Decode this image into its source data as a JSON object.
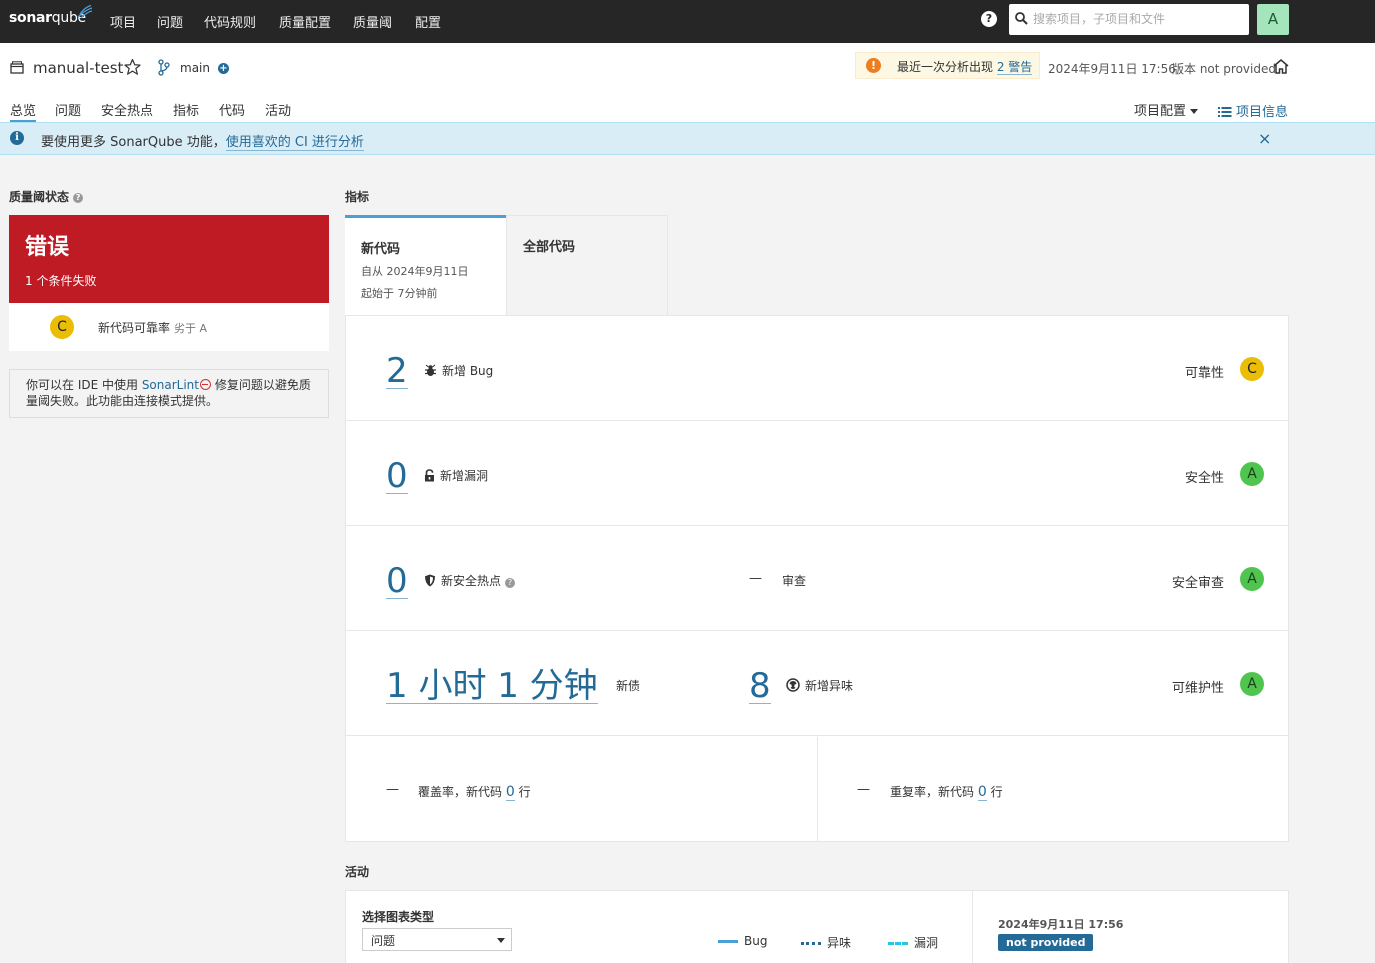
{
  "topnav": {
    "logo_bold": "sonar",
    "logo_light": "qube",
    "items": [
      "项目",
      "问题",
      "代码规则",
      "质量配置",
      "质量阈",
      "配置"
    ],
    "help": "?",
    "search_placeholder": "搜索项目，子项目和文件",
    "avatar": "A"
  },
  "project": {
    "name": "manual-test",
    "branch": "main",
    "warning_text": "最近一次分析出现",
    "warning_link": "2 警告",
    "analysis_date": "2024年9月11日 17:56",
    "version": "版本 not provided",
    "tabs": [
      "总览",
      "问题",
      "安全热点",
      "指标",
      "代码",
      "活动"
    ],
    "settings": "项目配置",
    "info": "项目信息"
  },
  "banner": {
    "text": "要使用更多 SonarQube 功能，",
    "link": "使用喜欢的 CI 进行分析",
    "close": "×"
  },
  "quality_gate": {
    "title": "质量阈状态",
    "status": "错误",
    "failed": "1 个条件失败",
    "condition_rating": "C",
    "condition_text": "新代码可靠率",
    "condition_sub": "劣于 A",
    "sonarlint_pre": "你可以在 IDE 中使用 ",
    "sonarlint_link": "SonarLint",
    "sonarlint_post": " 修复问题以避免质量阈失败。此功能由连接模式提供。"
  },
  "measures": {
    "title": "指标",
    "tab_new": "新代码",
    "tab_new_since": "自从 2024年9月11日",
    "tab_new_started": "起始于 7分钟前",
    "tab_all": "全部代码",
    "bugs": "2",
    "bugs_label": "新增 Bug",
    "reliability": "可靠性",
    "reliability_rating": "C",
    "vulns": "0",
    "vulns_label": "新增漏洞",
    "security": "安全性",
    "security_rating": "A",
    "hotspots": "0",
    "hotspots_label": "新安全热点",
    "review_dash": "—",
    "review_label": "审查",
    "security_review": "安全审查",
    "security_review_rating": "A",
    "debt": "1 小时 1 分钟",
    "debt_label": "新债",
    "smells": "8",
    "smells_label": "新增异味",
    "maintainability": "可维护性",
    "maintainability_rating": "A",
    "coverage_dash": "—",
    "coverage_label": "覆盖率，新代码",
    "coverage_lines": "0",
    "coverage_unit": "行",
    "dup_dash": "—",
    "dup_label": "重复率，新代码",
    "dup_lines": "0",
    "dup_unit": "行"
  },
  "activity": {
    "title": "活动",
    "chart_type_label": "选择图表类型",
    "chart_type_value": "问题",
    "legend": [
      "Bug",
      "异味",
      "漏洞"
    ],
    "date": "2024年9月11日 17:56",
    "badge": "not provided"
  },
  "colors": {
    "error_red": "#be1b25",
    "rating_c": "#eabe06",
    "rating_a": "#4fc54f",
    "link_blue": "#236a97",
    "accent_blue": "#4b9fd5"
  }
}
